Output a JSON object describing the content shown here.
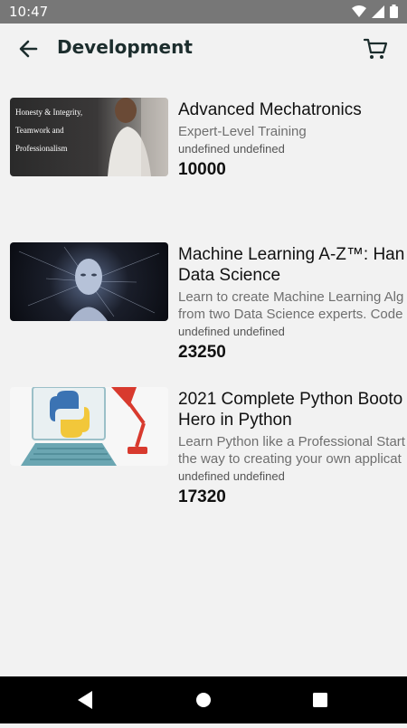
{
  "status": {
    "time": "10:47"
  },
  "header": {
    "title": "Development"
  },
  "courses": [
    {
      "title": "Advanced Mechatronics",
      "description": "Expert-Level Training",
      "author": "undefined undefined",
      "price": "10000",
      "thumb_text": [
        "Honesty & Integrity,",
        "Teamwork and",
        "Professionalism"
      ]
    },
    {
      "title_lines": [
        "Machine Learning A-Z™: Han",
        "Data Science"
      ],
      "description_lines": [
        "Learn to create Machine Learning Alg",
        "from two Data Science experts. Code"
      ],
      "author": "undefined undefined",
      "price": "23250"
    },
    {
      "title_lines": [
        "2021 Complete Python Booto",
        "Hero in Python"
      ],
      "description_lines": [
        "Learn Python like a Professional Start",
        "the way to creating your own applicat"
      ],
      "author": "undefined undefined",
      "price": "17320"
    }
  ],
  "icons": {
    "back": "arrow-left-icon",
    "cart": "cart-icon",
    "nav_back": "triangle-back-icon",
    "nav_home": "circle-home-icon",
    "nav_recents": "square-recents-icon"
  }
}
